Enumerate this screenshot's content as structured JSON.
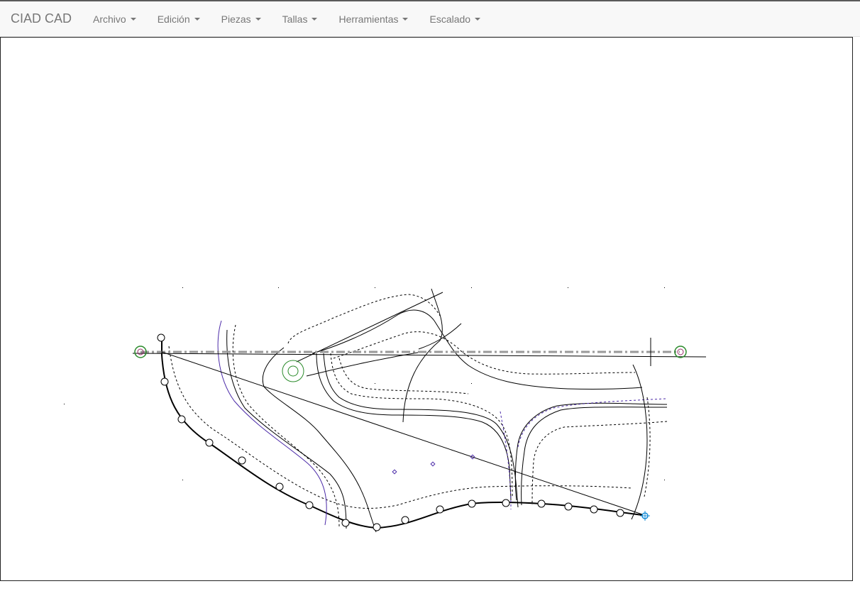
{
  "app": {
    "brand": "CIAD CAD"
  },
  "menu": {
    "items": [
      {
        "label": "Archivo",
        "icon": "caret-down-icon"
      },
      {
        "label": "Edición",
        "icon": "caret-down-icon"
      },
      {
        "label": "Piezas",
        "icon": "caret-down-icon"
      },
      {
        "label": "Tallas",
        "icon": "caret-down-icon"
      },
      {
        "label": "Herramientas",
        "icon": "caret-down-icon"
      },
      {
        "label": "Escalado",
        "icon": "caret-down-icon"
      }
    ]
  },
  "colors": {
    "navbar_bg": "#f8f8f8",
    "navbar_text": "#777777",
    "pattern_line": "#000000",
    "seam_line": "#4b2aa8",
    "grain_line": "#999999",
    "anchor_green": "#2a8a2a",
    "selected_point": "#1a8fd8"
  }
}
